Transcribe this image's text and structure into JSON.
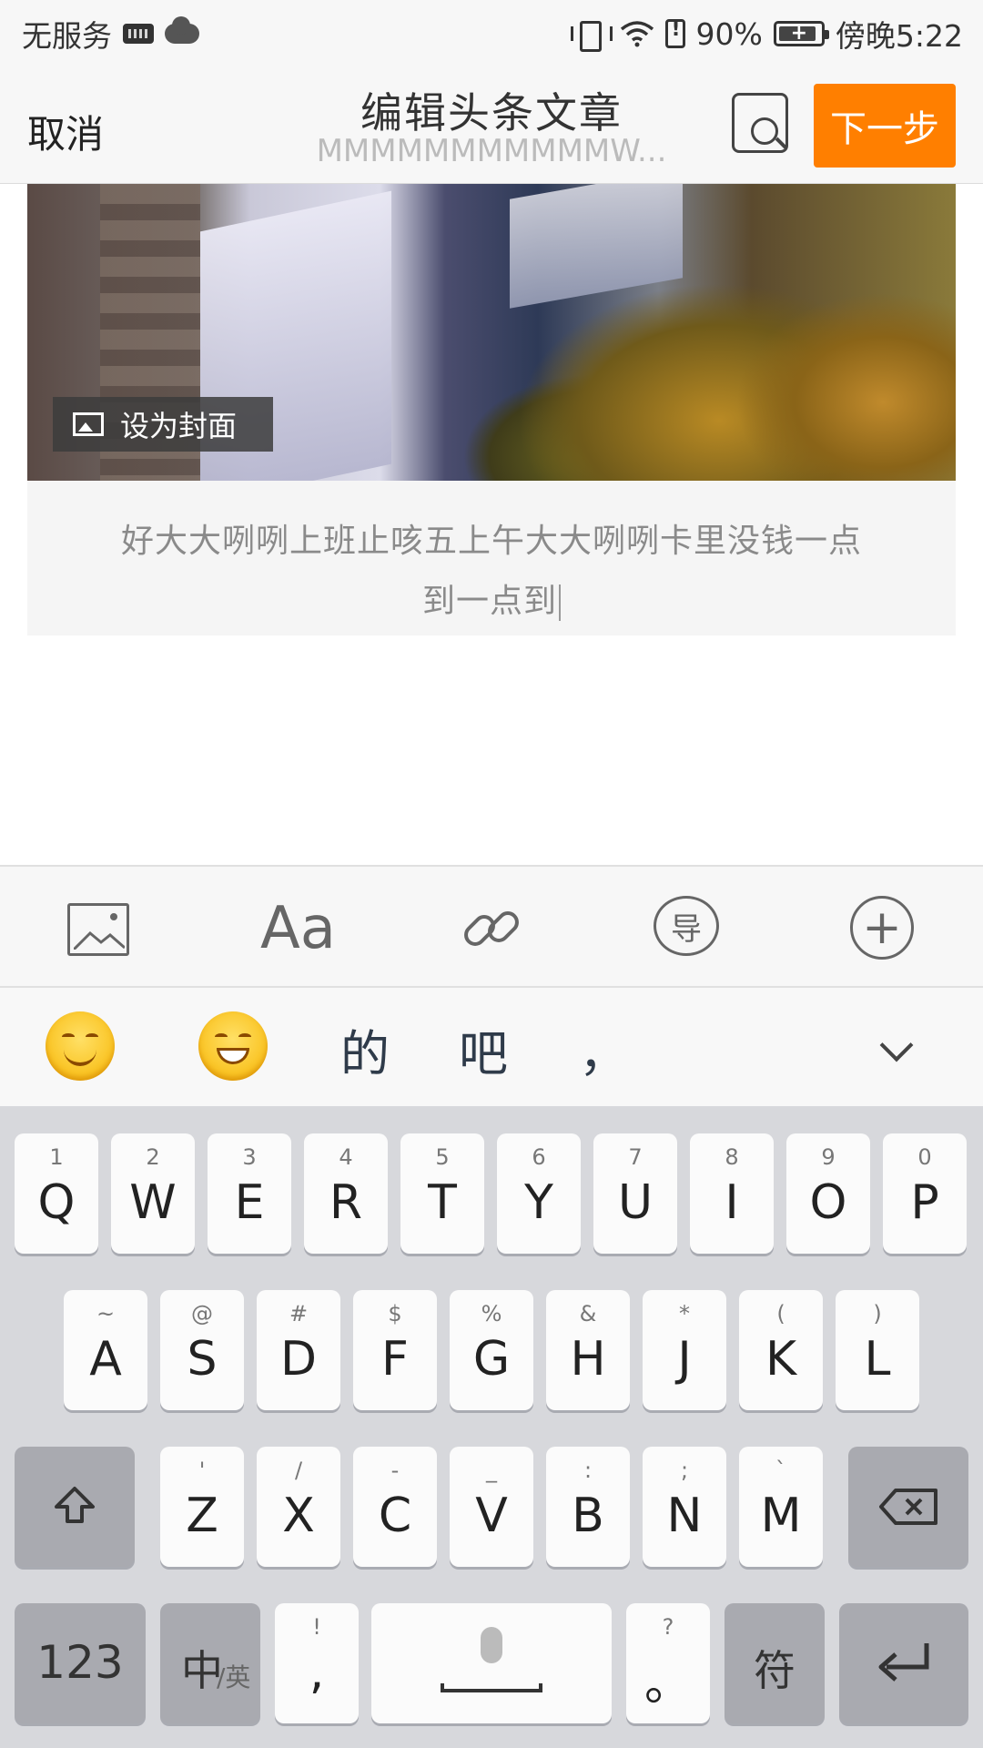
{
  "status_bar": {
    "carrier": "无服务",
    "battery_percent": "90%",
    "time": "傍晚5:22",
    "icons": [
      "keyboard-icon",
      "cloud-icon",
      "vibrate-icon",
      "wifi-icon",
      "battery-alert-icon",
      "battery-charging-icon"
    ]
  },
  "header": {
    "cancel_label": "取消",
    "title": "编辑头条文章",
    "subtitle": "MMMMMMMMMMMW...",
    "next_label": "下一步",
    "preview_icon": "preview-search-icon",
    "accent_color": "#ff7f00"
  },
  "content": {
    "set_cover_label": "设为封面",
    "caption_line1": "好大大咧咧上班止咳五上午大大咧咧卡里没钱一点",
    "caption_line2": "到一点到"
  },
  "toolbar": {
    "font_label": "Aa",
    "guide_label": "导",
    "add_label": "+",
    "icons": [
      "image-icon",
      "font-icon",
      "link-icon",
      "guide-icon",
      "add-icon"
    ]
  },
  "suggestions": {
    "words": [
      "的",
      "吧",
      "，"
    ],
    "emojis": [
      "smile-emoji",
      "grin-emoji"
    ]
  },
  "keyboard": {
    "row1": [
      {
        "hint": "1",
        "key": "Q"
      },
      {
        "hint": "2",
        "key": "W"
      },
      {
        "hint": "3",
        "key": "E"
      },
      {
        "hint": "4",
        "key": "R"
      },
      {
        "hint": "5",
        "key": "T"
      },
      {
        "hint": "6",
        "key": "Y"
      },
      {
        "hint": "7",
        "key": "U"
      },
      {
        "hint": "8",
        "key": "I"
      },
      {
        "hint": "9",
        "key": "O"
      },
      {
        "hint": "0",
        "key": "P"
      }
    ],
    "row2": [
      {
        "hint": "~",
        "key": "A"
      },
      {
        "hint": "@",
        "key": "S"
      },
      {
        "hint": "#",
        "key": "D"
      },
      {
        "hint": "$",
        "key": "F"
      },
      {
        "hint": "%",
        "key": "G"
      },
      {
        "hint": "&",
        "key": "H"
      },
      {
        "hint": "*",
        "key": "J"
      },
      {
        "hint": "(",
        "key": "K"
      },
      {
        "hint": ")",
        "key": "L"
      }
    ],
    "row3": [
      {
        "hint": "'",
        "key": "Z"
      },
      {
        "hint": "/",
        "key": "X"
      },
      {
        "hint": "-",
        "key": "C"
      },
      {
        "hint": "_",
        "key": "V"
      },
      {
        "hint": ":",
        "key": "B"
      },
      {
        "hint": ";",
        "key": "N"
      },
      {
        "hint": "`",
        "key": "M"
      }
    ],
    "num_label": "123",
    "lang_main": "中",
    "lang_sub": "/英",
    "comma_hint": "!",
    "comma_key": ",",
    "period_hint": "?",
    "period_key": "。",
    "symbol_label": "符"
  }
}
